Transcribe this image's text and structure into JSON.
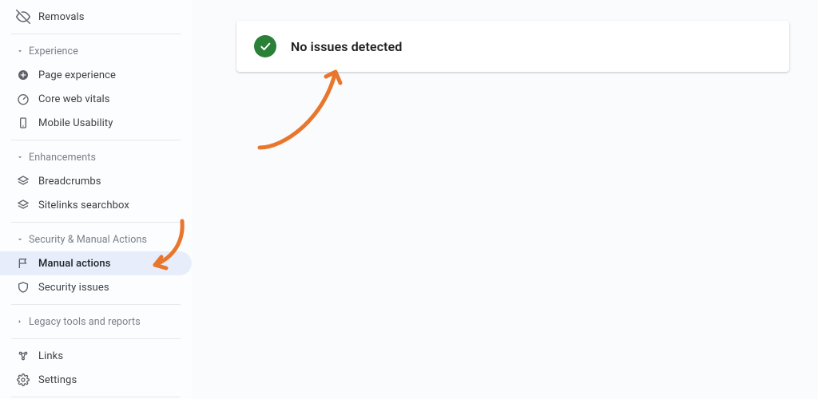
{
  "sidebar": {
    "top_item": {
      "label": "Removals"
    },
    "groups": {
      "experience": {
        "label": "Experience",
        "items": [
          {
            "label": "Page experience"
          },
          {
            "label": "Core web vitals"
          },
          {
            "label": "Mobile Usability"
          }
        ]
      },
      "enhancements": {
        "label": "Enhancements",
        "items": [
          {
            "label": "Breadcrumbs"
          },
          {
            "label": "Sitelinks searchbox"
          }
        ]
      },
      "security": {
        "label": "Security & Manual Actions",
        "items": [
          {
            "label": "Manual actions"
          },
          {
            "label": "Security issues"
          }
        ]
      },
      "legacy": {
        "label": "Legacy tools and reports"
      }
    },
    "bottom": {
      "links": {
        "label": "Links"
      },
      "settings": {
        "label": "Settings"
      }
    }
  },
  "status_card": {
    "message": "No issues detected"
  }
}
